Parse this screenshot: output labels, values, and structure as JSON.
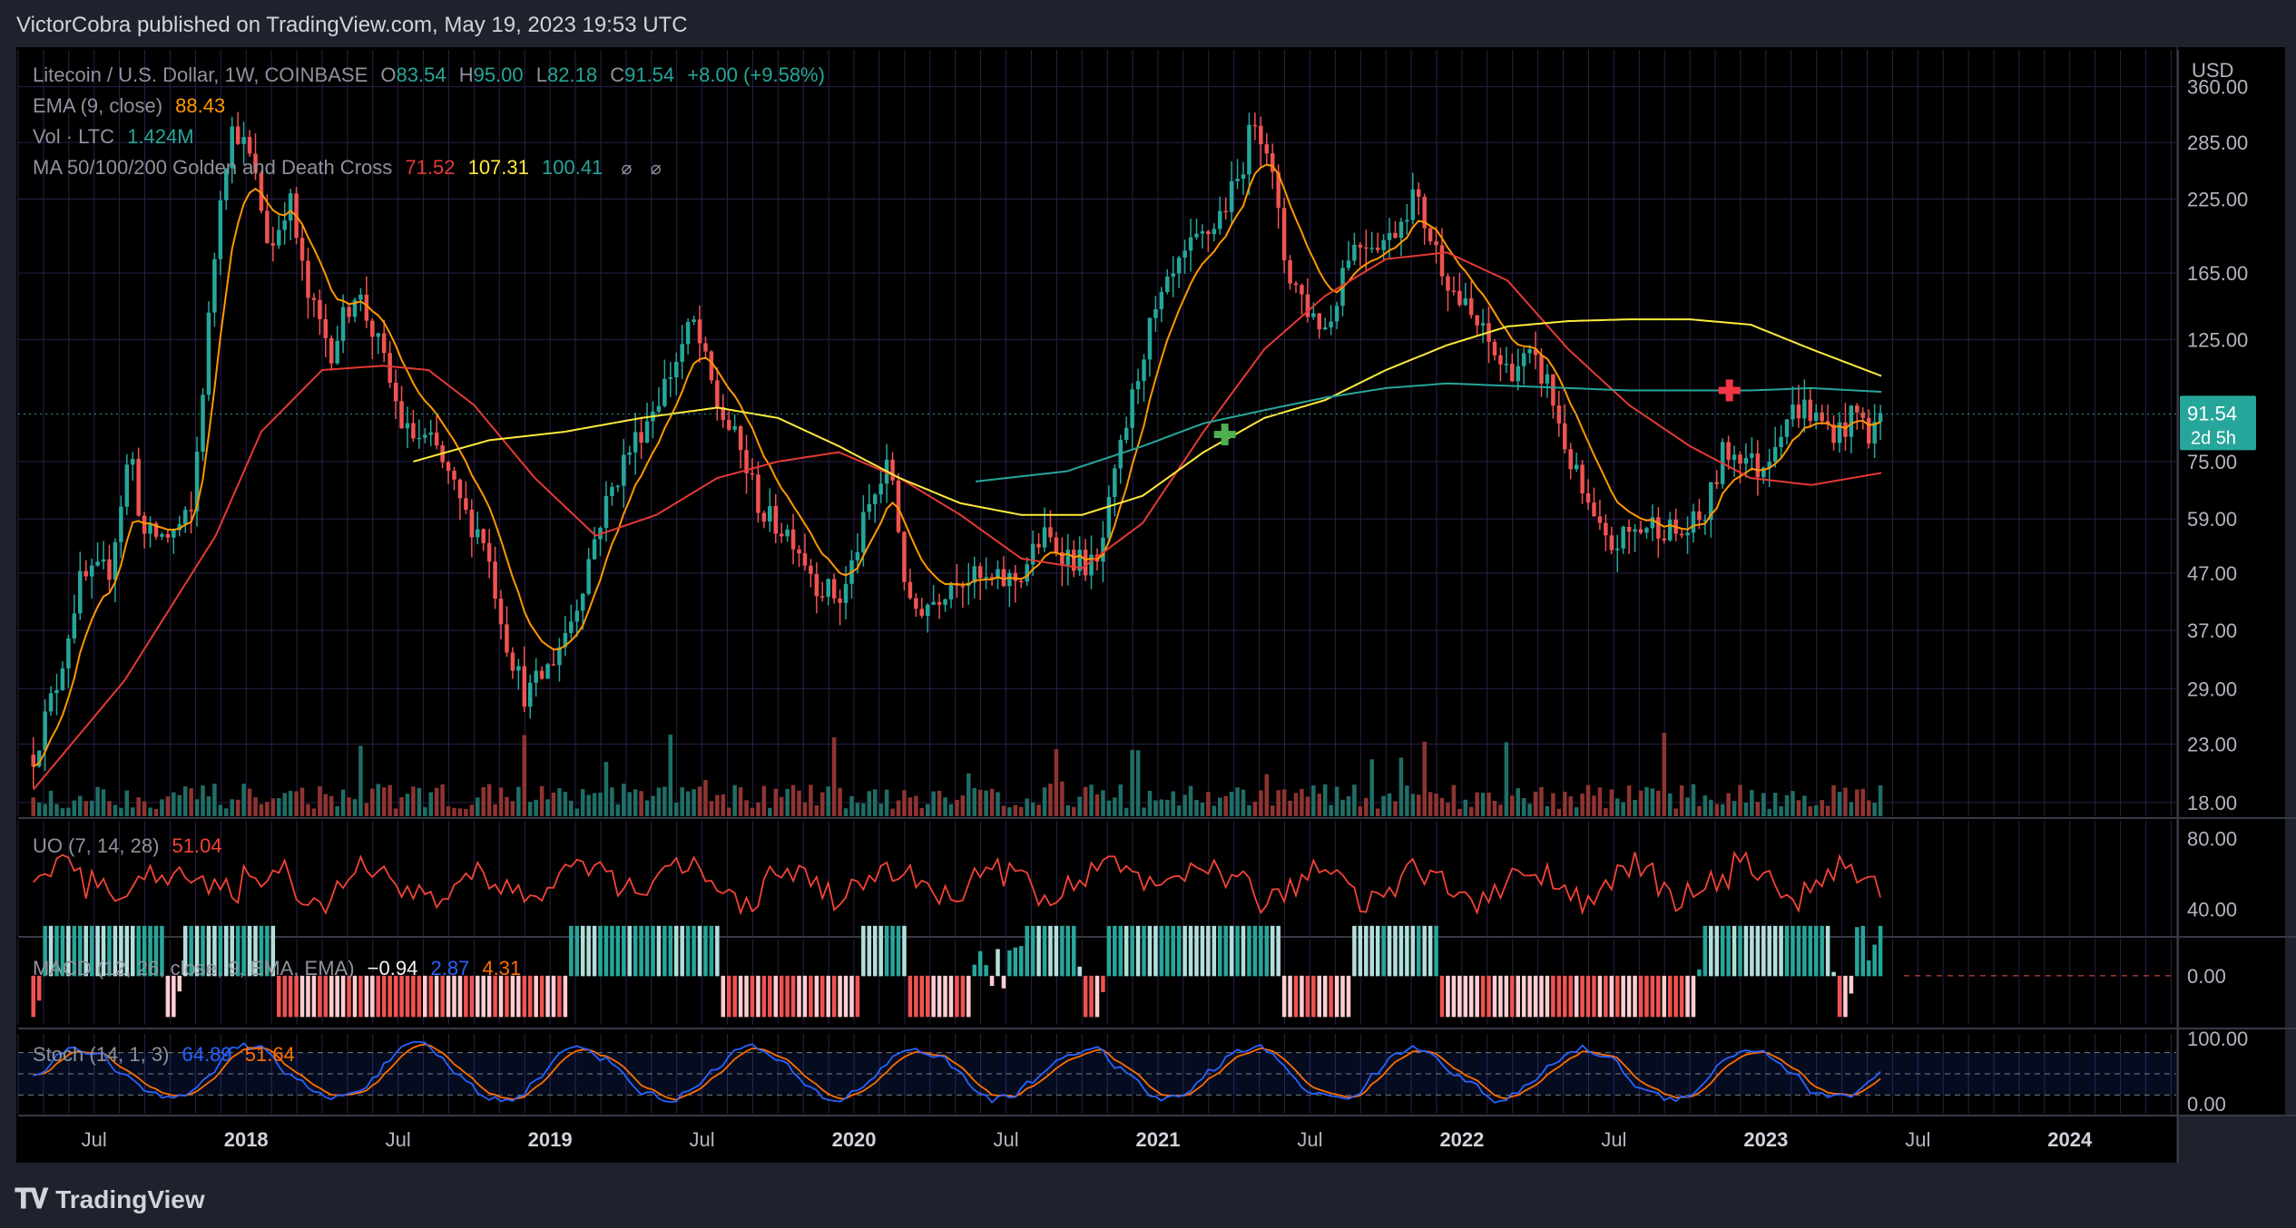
{
  "header": {
    "published_by": "VictorCobra published on TradingView.com, May 19, 2023 19:53 UTC"
  },
  "legend": {
    "symbol": "Litecoin / U.S. Dollar, 1W, COINBASE",
    "o_label": "O",
    "o": "83.54",
    "h_label": "H",
    "h": "95.00",
    "l_label": "L",
    "l": "82.18",
    "c_label": "C",
    "c": "91.54",
    "change": "+8.00 (+9.58%)",
    "ema_label": "EMA (9, close)",
    "ema_value": "88.43",
    "vol_label": "Vol · LTC",
    "vol_value": "1.424M",
    "ma_label": "MA 50/100/200 Golden and Death Cross",
    "ma50": "71.52",
    "ma100": "107.31",
    "ma200": "100.41",
    "icons": [
      "eye-off-icon",
      "eye-off-icon"
    ]
  },
  "indicators": {
    "uo_label": "UO (7, 14, 28)",
    "uo_value": "51.04",
    "macd_label": "MACD (12, 26, close, 9, EMA, EMA)",
    "macd_hist": "−0.94",
    "macd_line": "2.87",
    "macd_signal": "4.31",
    "stoch_label": "Stoch (14, 1, 3)",
    "stoch_k": "64.89",
    "stoch_d": "51.64"
  },
  "price_axis": {
    "currency": "USD",
    "ticks": [
      "360.00",
      "285.00",
      "225.00",
      "165.00",
      "125.00",
      "75.00",
      "59.00",
      "47.00",
      "37.00",
      "29.00",
      "23.00",
      "18.00"
    ],
    "last_price": "91.54",
    "countdown": "2d 5h"
  },
  "uo_axis": [
    "80.00",
    "40.00"
  ],
  "macd_axis": [
    "0.00"
  ],
  "stoch_axis": [
    "100.00",
    "0.00"
  ],
  "time_axis": [
    {
      "label": "Jul",
      "bold": false,
      "year": 2017.5
    },
    {
      "label": "2018",
      "bold": true,
      "year": 2018.0
    },
    {
      "label": "Jul",
      "bold": false,
      "year": 2018.5
    },
    {
      "label": "2019",
      "bold": true,
      "year": 2019.0
    },
    {
      "label": "Jul",
      "bold": false,
      "year": 2019.5
    },
    {
      "label": "2020",
      "bold": true,
      "year": 2020.0
    },
    {
      "label": "Jul",
      "bold": false,
      "year": 2020.5
    },
    {
      "label": "2021",
      "bold": true,
      "year": 2021.0
    },
    {
      "label": "Jul",
      "bold": false,
      "year": 2021.5
    },
    {
      "label": "2022",
      "bold": true,
      "year": 2022.0
    },
    {
      "label": "Jul",
      "bold": false,
      "year": 2022.5
    },
    {
      "label": "2023",
      "bold": true,
      "year": 2023.0
    },
    {
      "label": "Jul",
      "bold": false,
      "year": 2023.5
    },
    {
      "label": "2024",
      "bold": true,
      "year": 2024.0
    }
  ],
  "footer": {
    "brand": "TradingView"
  },
  "colors": {
    "up": "#26a69a",
    "down": "#ef5350",
    "ema": "#ff9800",
    "ma50": "#e53935",
    "ma100": "#ffeb3b",
    "ma200": "#26a69a",
    "uo": "#f44336",
    "macd": "#2962ff",
    "signal": "#ff6d00",
    "stoch_k": "#2962ff",
    "stoch_d": "#ff6d00",
    "grid": "#2a1f4a"
  },
  "chart_data": {
    "type": "candlestick",
    "title": "Litecoin / U.S. Dollar, 1W, COINBASE",
    "scale": "log",
    "ylim": [
      17,
      420
    ],
    "xlim": [
      2017.25,
      2024.35
    ],
    "price_keypoints": [
      [
        2017.3,
        22
      ],
      [
        2017.38,
        30
      ],
      [
        2017.45,
        45
      ],
      [
        2017.55,
        48
      ],
      [
        2017.62,
        80
      ],
      [
        2017.66,
        55
      ],
      [
        2017.75,
        55
      ],
      [
        2017.82,
        60
      ],
      [
        2017.92,
        250
      ],
      [
        2017.96,
        310
      ],
      [
        2018.02,
        260
      ],
      [
        2018.08,
        180
      ],
      [
        2018.14,
        230
      ],
      [
        2018.2,
        150
      ],
      [
        2018.28,
        120
      ],
      [
        2018.36,
        155
      ],
      [
        2018.44,
        120
      ],
      [
        2018.52,
        85
      ],
      [
        2018.62,
        80
      ],
      [
        2018.72,
        60
      ],
      [
        2018.78,
        55
      ],
      [
        2018.86,
        35
      ],
      [
        2018.92,
        28
      ],
      [
        2019.0,
        32
      ],
      [
        2019.08,
        40
      ],
      [
        2019.16,
        58
      ],
      [
        2019.24,
        75
      ],
      [
        2019.32,
        90
      ],
      [
        2019.4,
        110
      ],
      [
        2019.47,
        135
      ],
      [
        2019.55,
        95
      ],
      [
        2019.62,
        80
      ],
      [
        2019.7,
        60
      ],
      [
        2019.8,
        55
      ],
      [
        2019.88,
        45
      ],
      [
        2019.96,
        42
      ],
      [
        2020.04,
        60
      ],
      [
        2020.12,
        75
      ],
      [
        2020.18,
        40
      ],
      [
        2020.26,
        42
      ],
      [
        2020.34,
        47
      ],
      [
        2020.44,
        45
      ],
      [
        2020.54,
        46
      ],
      [
        2020.62,
        55
      ],
      [
        2020.72,
        50
      ],
      [
        2020.8,
        48
      ],
      [
        2020.88,
        80
      ],
      [
        2020.96,
        125
      ],
      [
        2021.02,
        150
      ],
      [
        2021.1,
        180
      ],
      [
        2021.18,
        200
      ],
      [
        2021.26,
        240
      ],
      [
        2021.32,
        320
      ],
      [
        2021.36,
        280
      ],
      [
        2021.42,
        170
      ],
      [
        2021.5,
        140
      ],
      [
        2021.56,
        130
      ],
      [
        2021.62,
        180
      ],
      [
        2021.68,
        190
      ],
      [
        2021.76,
        190
      ],
      [
        2021.84,
        230
      ],
      [
        2021.9,
        190
      ],
      [
        2021.98,
        150
      ],
      [
        2022.06,
        130
      ],
      [
        2022.14,
        110
      ],
      [
        2022.22,
        115
      ],
      [
        2022.28,
        105
      ],
      [
        2022.34,
        80
      ],
      [
        2022.42,
        60
      ],
      [
        2022.48,
        52
      ],
      [
        2022.56,
        56
      ],
      [
        2022.64,
        58
      ],
      [
        2022.72,
        55
      ],
      [
        2022.8,
        60
      ],
      [
        2022.86,
        78
      ],
      [
        2022.92,
        78
      ],
      [
        2022.98,
        72
      ],
      [
        2023.06,
        90
      ],
      [
        2023.12,
        95
      ],
      [
        2023.18,
        88
      ],
      [
        2023.24,
        85
      ],
      [
        2023.3,
        92
      ],
      [
        2023.34,
        84
      ],
      [
        2023.38,
        91.54
      ]
    ],
    "ma50_points": [
      [
        2017.3,
        19
      ],
      [
        2017.6,
        30
      ],
      [
        2017.9,
        55
      ],
      [
        2018.05,
        85
      ],
      [
        2018.25,
        110
      ],
      [
        2018.45,
        112
      ],
      [
        2018.6,
        110
      ],
      [
        2018.75,
        95
      ],
      [
        2018.95,
        70
      ],
      [
        2019.15,
        55
      ],
      [
        2019.35,
        60
      ],
      [
        2019.55,
        70
      ],
      [
        2019.75,
        75
      ],
      [
        2019.95,
        78
      ],
      [
        2020.15,
        70
      ],
      [
        2020.35,
        60
      ],
      [
        2020.55,
        50
      ],
      [
        2020.75,
        48
      ],
      [
        2020.95,
        58
      ],
      [
        2021.15,
        85
      ],
      [
        2021.35,
        120
      ],
      [
        2021.55,
        150
      ],
      [
        2021.75,
        175
      ],
      [
        2021.95,
        180
      ],
      [
        2022.15,
        160
      ],
      [
        2022.35,
        120
      ],
      [
        2022.55,
        95
      ],
      [
        2022.75,
        80
      ],
      [
        2022.95,
        70
      ],
      [
        2023.15,
        68
      ],
      [
        2023.38,
        71.52
      ]
    ],
    "ma100_points": [
      [
        2018.55,
        75
      ],
      [
        2018.8,
        82
      ],
      [
        2019.05,
        85
      ],
      [
        2019.3,
        90
      ],
      [
        2019.55,
        94
      ],
      [
        2019.75,
        90
      ],
      [
        2019.95,
        80
      ],
      [
        2020.15,
        70
      ],
      [
        2020.35,
        63
      ],
      [
        2020.55,
        60
      ],
      [
        2020.75,
        60
      ],
      [
        2020.95,
        65
      ],
      [
        2021.15,
        78
      ],
      [
        2021.35,
        90
      ],
      [
        2021.55,
        97
      ],
      [
        2021.75,
        110
      ],
      [
        2021.95,
        122
      ],
      [
        2022.15,
        132
      ],
      [
        2022.35,
        135
      ],
      [
        2022.55,
        136
      ],
      [
        2022.75,
        136
      ],
      [
        2022.95,
        133
      ],
      [
        2023.15,
        120
      ],
      [
        2023.38,
        107.31
      ]
    ],
    "ma200_points": [
      [
        2020.4,
        69
      ],
      [
        2020.7,
        72
      ],
      [
        2020.95,
        80
      ],
      [
        2021.15,
        88
      ],
      [
        2021.35,
        93
      ],
      [
        2021.55,
        98
      ],
      [
        2021.75,
        102
      ],
      [
        2021.95,
        104
      ],
      [
        2022.15,
        103
      ],
      [
        2022.35,
        102
      ],
      [
        2022.55,
        101
      ],
      [
        2022.75,
        101
      ],
      [
        2022.95,
        101
      ],
      [
        2023.15,
        102
      ],
      [
        2023.38,
        100.41
      ]
    ],
    "cross_markers": [
      {
        "type": "golden",
        "year": 2021.22,
        "price": 84
      },
      {
        "type": "death",
        "year": 2022.88,
        "price": 101
      }
    ]
  }
}
